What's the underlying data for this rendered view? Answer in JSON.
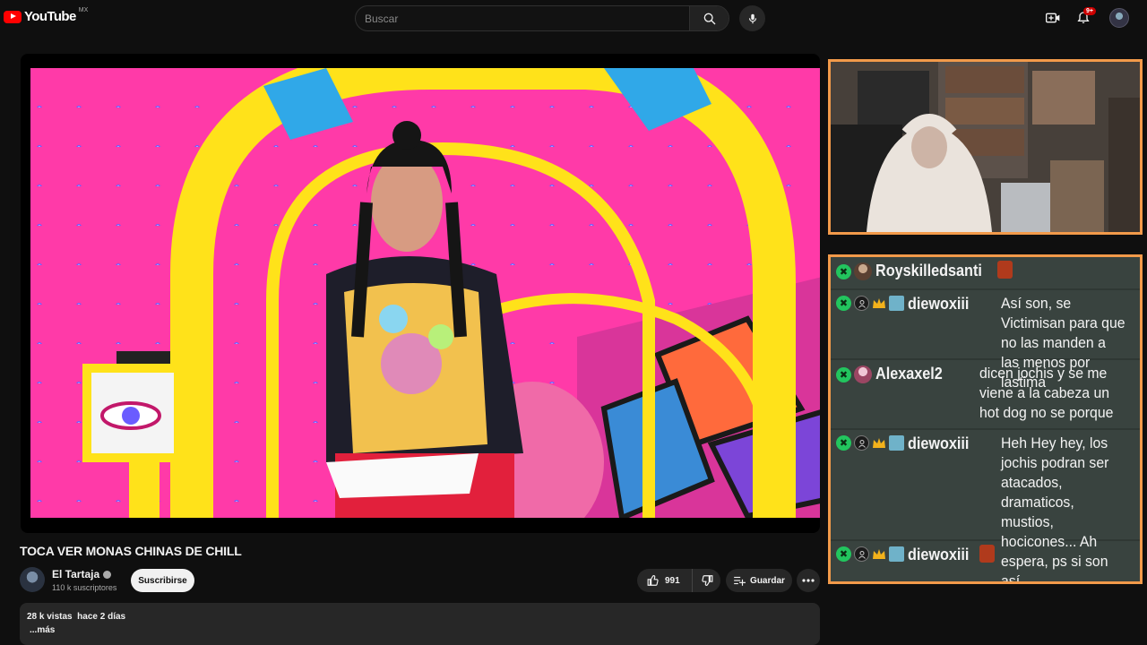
{
  "header": {
    "logo_text": "YouTube",
    "region": "MX",
    "search_placeholder": "Buscar",
    "notifications_badge": "9+"
  },
  "video": {
    "title": "TOCA VER MONAS CHINAS DE CHILL"
  },
  "channel": {
    "name": "El Tartaja",
    "subscribers": "110 k suscriptores",
    "subscribe_label": "Suscribirse"
  },
  "actions": {
    "likes": "991",
    "save_label": "Guardar"
  },
  "description": {
    "views": "28 k vistas",
    "date": "hace 2 días",
    "more_label": "...más"
  },
  "chat": {
    "messages": [
      {
        "user": "Royskilledsanti",
        "text": ""
      },
      {
        "user": "diewoxiii",
        "text": "Así son, se Victimisan para que no las manden a las menos por lastima"
      },
      {
        "user": "Alexaxel2",
        "text": "dicen jochis y se me viene a la cabeza un hot dog no se porque"
      },
      {
        "user": "diewoxiii",
        "text": "Heh Hey hey, los jochis podran ser atacados, dramaticos, mustios, hocicones... Ah espera, ps si son así"
      },
      {
        "user": "diewoxiii",
        "text": ""
      }
    ]
  },
  "colors": {
    "accent": "#ff0000",
    "overlay_border": "#f29a4a",
    "chat_bg": "#39433f",
    "chat_badge": "#22c55e"
  }
}
